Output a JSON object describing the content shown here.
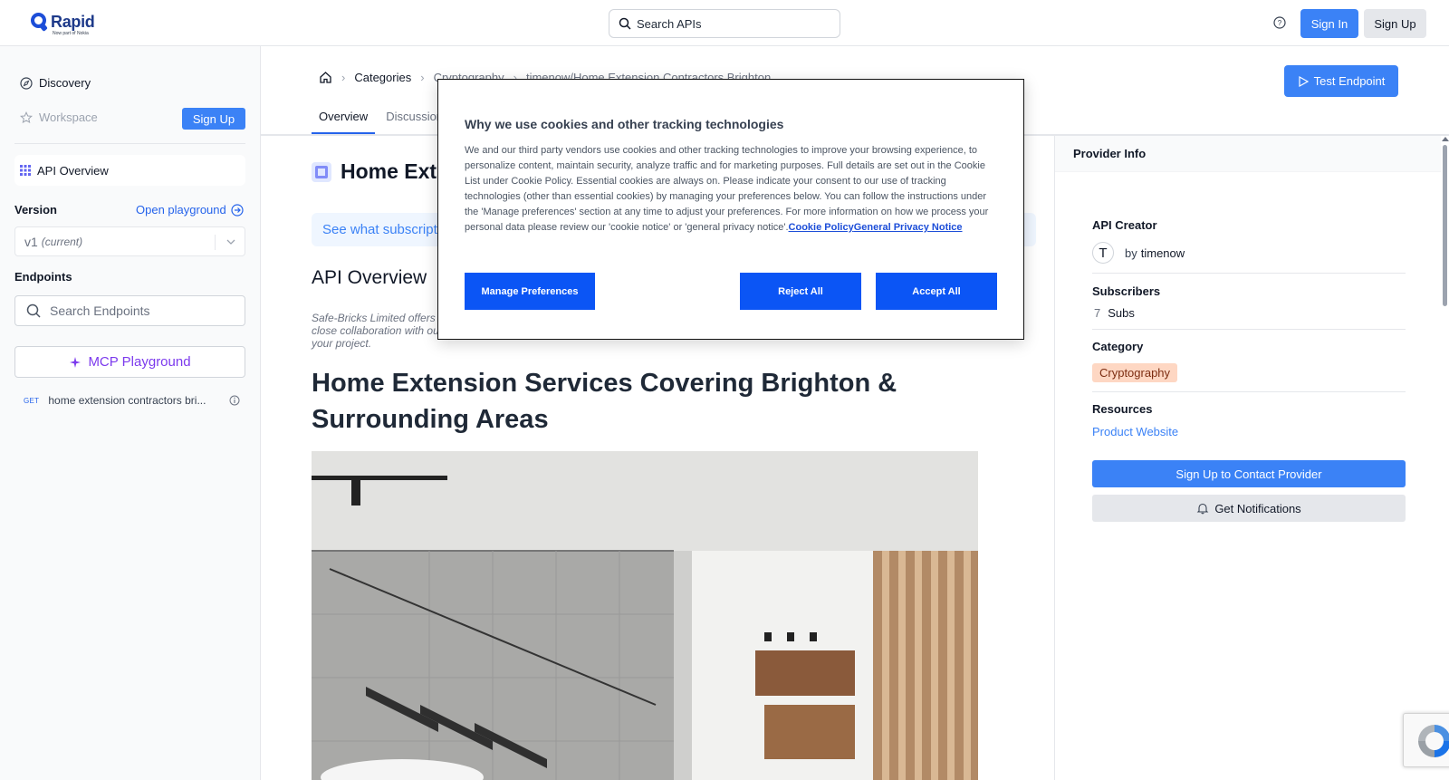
{
  "header": {
    "logo_name": "Rapid",
    "logo_sub": "Now part of Nokia",
    "search_placeholder": "Search APIs",
    "signin_label": "Sign In",
    "signup_label": "Sign Up"
  },
  "sidebar": {
    "discovery_label": "Discovery",
    "workspace_label": "Workspace",
    "signup_label": "Sign Up",
    "api_overview_label": "API Overview",
    "version_label": "Version",
    "open_playground_label": "Open playground",
    "version_value": "v1",
    "version_current": "(current)",
    "endpoints_label": "Endpoints",
    "search_endpoints_placeholder": "Search Endpoints",
    "mcp_playground_label": "MCP Playground",
    "endpoint": {
      "method": "GET",
      "name": "home extension contractors bri..."
    }
  },
  "main": {
    "breadcrumb": {
      "categories": "Categories",
      "crumb_2": "Cryptography",
      "crumb_3": "timenow/Home Extension Contractors Brighton"
    },
    "test_endpoint_label": "Test Endpoint",
    "tabs": [
      {
        "label": "Overview"
      },
      {
        "label": "Discussions"
      }
    ],
    "api_title": "Home Extension Contractors Brighton",
    "subscription_banner": "See what subscription plans are available for this API",
    "overview_heading": "API Overview",
    "description": "Safe-Bricks Limited offers home extension services covering Brighton & surrounding areas with a commitment to quality and excellence. We work in close collaboration with our clients to ensure every aspect of the extension is carefully planned and managed, giving you peace of mind throughout your project.",
    "big_heading": "Home Extension Services Covering Brighton & Surrounding Areas"
  },
  "provider": {
    "header_label": "Provider Info",
    "creator_label": "API Creator",
    "creator_initial": "T",
    "creator_by": "by",
    "creator_name": "timenow",
    "subscribers_label": "Subscribers",
    "subscribers_count": "7",
    "subscribers_unit": "Subs",
    "category_label": "Category",
    "category_value": "Cryptography",
    "resources_label": "Resources",
    "product_website_label": "Product Website",
    "contact_button": "Sign Up to Contact Provider",
    "notifications_button": "Get Notifications"
  },
  "cookie": {
    "title": "Why we use cookies and other tracking technologies",
    "body": "We and our third party vendors use cookies and other tracking technologies to improve your browsing experience, to personalize content, maintain security, analyze traffic and for marketing purposes. Full details are set out in the Cookie List under Cookie Policy. Essential cookies are always on. Please indicate your consent to our use of tracking technologies (other than essential cookies) by managing your preferences below. You can follow the instructions under the 'Manage preferences' section at any time to adjust your preferences. For more information on how we process your personal data please review our 'cookie notice' or 'general privacy notice'.",
    "link_cookie_policy": "Cookie Policy",
    "link_privacy": "General Privacy Notice",
    "manage_label": "Manage Preferences",
    "reject_label": "Reject All",
    "accept_label": "Accept All"
  },
  "colors": {
    "primary": "#3b82f6",
    "cookie_button": "#0b55f5",
    "mcp_purple": "#7c3aed",
    "category_badge": "#fed7c3"
  }
}
